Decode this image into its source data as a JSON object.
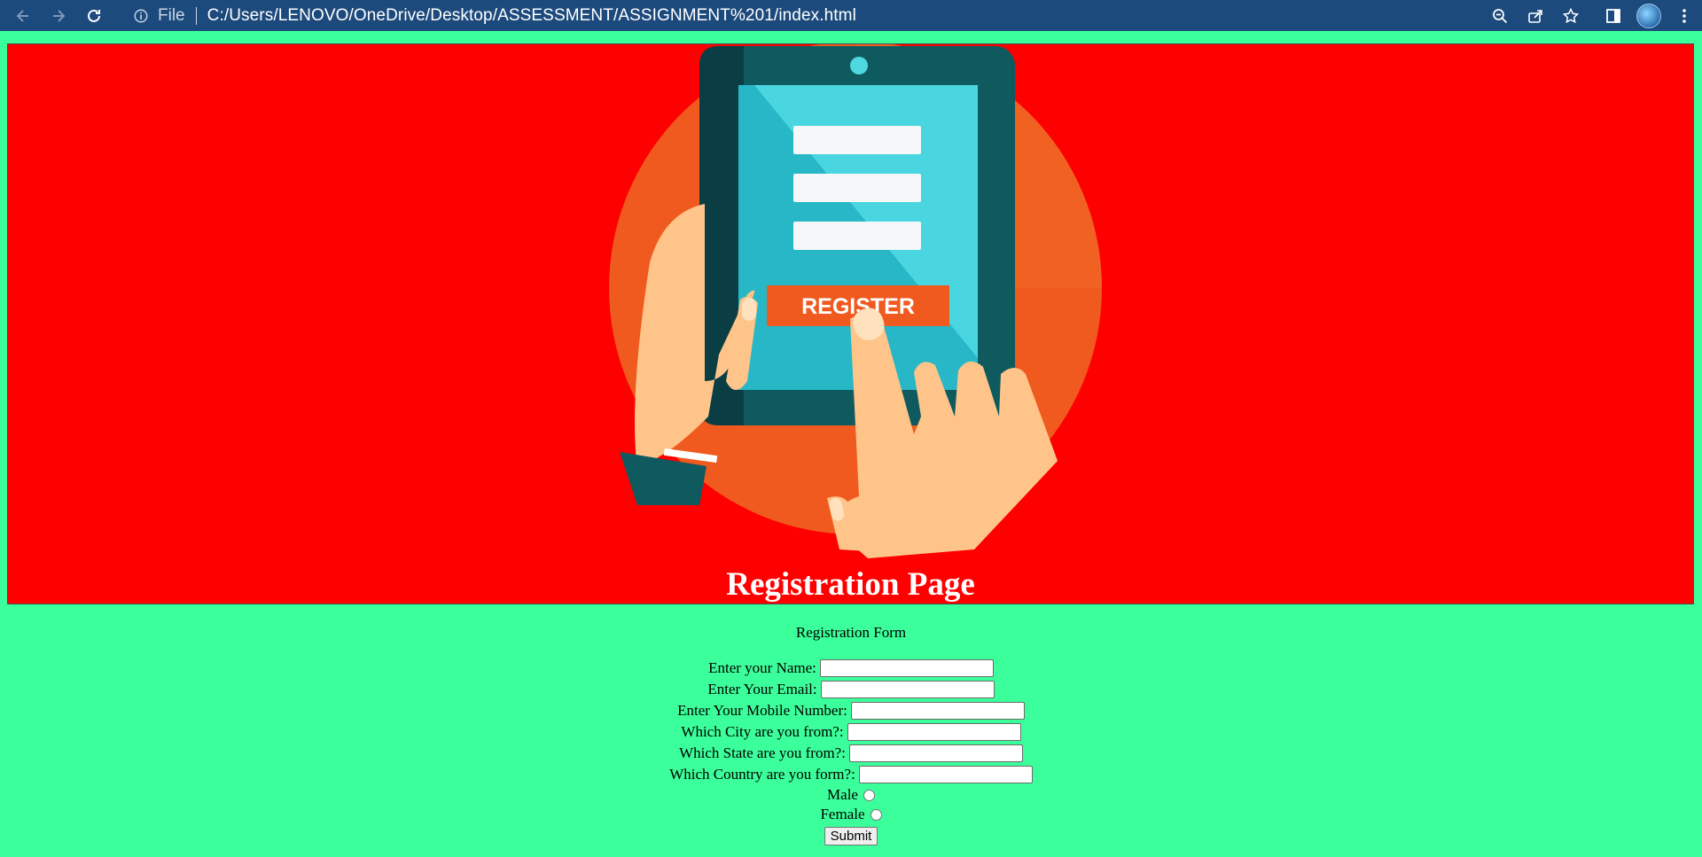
{
  "browser": {
    "scheme_label": "File",
    "url": "C:/Users/LENOVO/OneDrive/Desktop/ASSESSMENT/ASSIGNMENT%201/index.html",
    "icons": [
      "back-arrow-icon",
      "forward-arrow-icon",
      "reload-icon",
      "info-icon",
      "zoom-icon",
      "share-icon",
      "bookmark-star-icon",
      "side-panel-icon",
      "profile-avatar",
      "kebab-menu-icon"
    ]
  },
  "banner": {
    "background": "#ff0000",
    "illustration_button_text": "REGISTER",
    "title": "Registration Page"
  },
  "form": {
    "caption": "Registration Form",
    "fields": {
      "name_label": "Enter your Name:",
      "email_label": "Enter Your Email:",
      "mobile_label": "Enter Your Mobile Number:",
      "city_label": "Which City are you from?:",
      "state_label": "Which State are you from?:",
      "country_label": "Which Country are you form?:"
    },
    "gender": {
      "male_label": "Male",
      "female_label": "Female"
    },
    "submit_label": "Submit"
  },
  "colors": {
    "page_background": "#3bff9a",
    "chrome_background": "#1d4a7c"
  }
}
